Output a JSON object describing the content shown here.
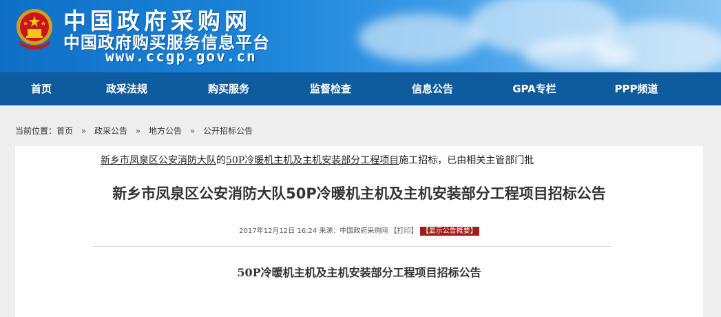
{
  "header": {
    "title": "中国政府采购网",
    "subtitle": "中国政府购买服务信息平台",
    "url": "www.ccgp.gov.cn"
  },
  "nav": {
    "items": [
      "首页",
      "政采法规",
      "购买服务",
      "监督检查",
      "信息公告",
      "GPA专栏",
      "PPP频道"
    ]
  },
  "breadcrumb": {
    "prefix": "当前位置：",
    "items": [
      "首页",
      "政采公告",
      "地方公告",
      "公开招标公告"
    ],
    "separator": "»"
  },
  "article": {
    "title": "新乡市凤泉区公安消防大队50P冷暖机主机及主机安装部分工程项目招标公告",
    "date": "2017年12月12日  16:24",
    "source_label": "来源：",
    "source": "中国政府采购网",
    "print_label": "【打印】",
    "summary_label": "【显示公告概要】",
    "doc_title": "50P冷暖机主机及主机安装部分工程项目招标公告",
    "body_part1": "新乡市凤泉区公安消防大队",
    "body_part2": "的",
    "body_part3": "50P冷暖机主机及主机安装部分工程项目",
    "body_part4": "施工招标，已由相关主管部门批"
  },
  "colors": {
    "nav_bg": "#0e5b9e",
    "summary_bg": "#a01b1b"
  }
}
